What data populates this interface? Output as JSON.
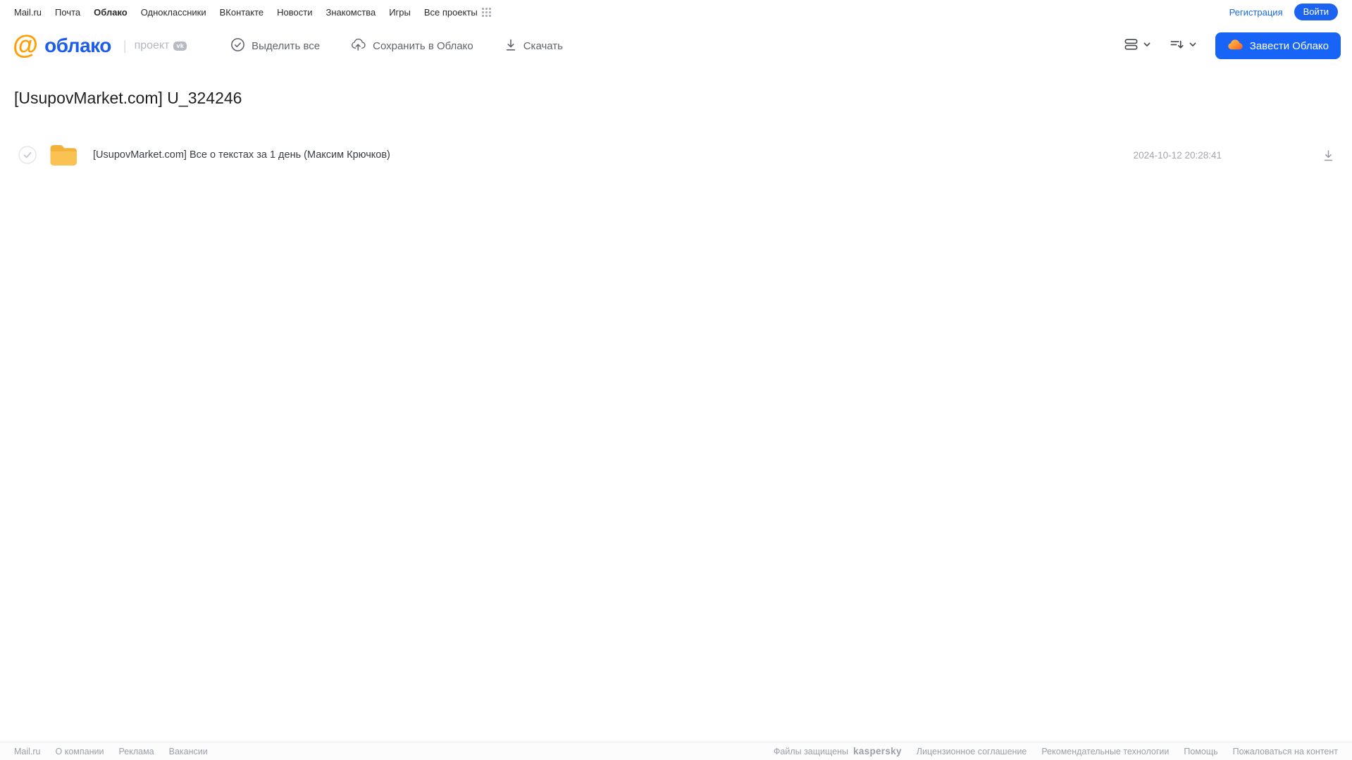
{
  "topnav": {
    "links": [
      {
        "label": "Mail.ru"
      },
      {
        "label": "Почта"
      },
      {
        "label": "Облако",
        "active": true
      },
      {
        "label": "Одноклассники"
      },
      {
        "label": "ВКонтакте"
      },
      {
        "label": "Новости"
      },
      {
        "label": "Знакомства"
      },
      {
        "label": "Игры"
      },
      {
        "label": "Все проекты"
      }
    ],
    "register_label": "Регистрация",
    "login_label": "Войти"
  },
  "header": {
    "logo_at": "@",
    "logo_text": "облако",
    "project_label": "проект",
    "vk_badge": "vk",
    "toolbar": {
      "select_all": "Выделить все",
      "save_to_cloud": "Сохранить в Облако",
      "download": "Скачать"
    },
    "get_cloud_label": "Завести Облако"
  },
  "main": {
    "title": "[UsupovMarket.com] U_324246",
    "files": [
      {
        "type": "folder",
        "name": "[UsupovMarket.com] Все о текстах за 1 день (Максим Крючков)",
        "date": "2024-10-12 20:28:41"
      }
    ]
  },
  "footer": {
    "left_links": [
      "Mail.ru",
      "О компании",
      "Реклама",
      "Вакансии"
    ],
    "protected_text": "Файлы защищены",
    "kaspersky_label": "kaspersky",
    "right_links": [
      "Лицензионное соглашение",
      "Рекомендательные технологии",
      "Помощь",
      "Пожаловаться на контент"
    ]
  },
  "icons": {
    "apps_grid": "grid-dots-3x3",
    "select_all": "check-circle",
    "save_to_cloud": "cloud-upload",
    "download": "arrow-down-underline",
    "view_mode": "list-view",
    "sort": "sort-lines-arrow",
    "chevron": "chevron-down",
    "brand_cloud": "orange-cloud",
    "folder": "folder-yellow",
    "row_checkbox": "circle-check"
  },
  "colors": {
    "accent_blue": "#1764f6",
    "logo_blue": "#1d5deb",
    "logo_orange": "#ff9e00",
    "folder_yellow": "#f8bb43",
    "kaspersky_teal": "#00a88e",
    "text_gray": "#5f636d",
    "footer_gray": "#9aa0a8"
  }
}
